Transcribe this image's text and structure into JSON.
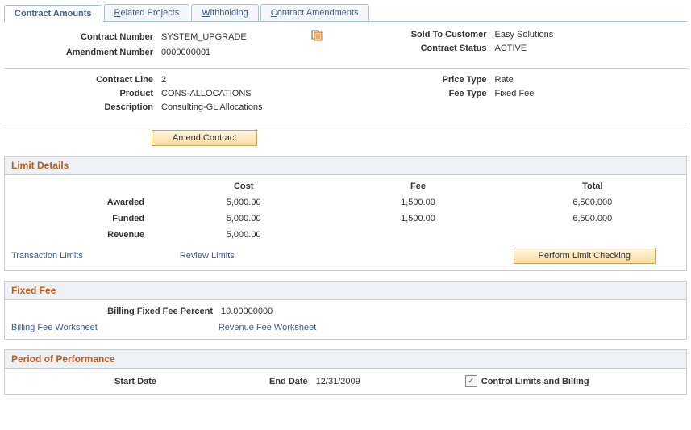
{
  "tabs": {
    "t0": "Contract Amounts",
    "t1_pre": "R",
    "t1_post": "elated Projects",
    "t2_pre": "W",
    "t2_post": "ithholding",
    "t3_pre": "C",
    "t3_post": "ontract Amendments"
  },
  "header": {
    "contract_number_label": "Contract Number",
    "contract_number": "SYSTEM_UPGRADE",
    "amendment_number_label": "Amendment Number",
    "amendment_number": "0000000001",
    "sold_to_label": "Sold To Customer",
    "sold_to": "Easy Solutions",
    "contract_status_label": "Contract Status",
    "contract_status": "ACTIVE",
    "contract_line_label": "Contract Line",
    "contract_line": "2",
    "product_label": "Product",
    "product": "CONS-ALLOCATIONS",
    "description_label": "Description",
    "description": "Consulting-GL Allocations",
    "price_type_label": "Price Type",
    "price_type": "Rate",
    "fee_type_label": "Fee Type",
    "fee_type": "Fixed Fee"
  },
  "actions": {
    "amend": "Amend Contract",
    "limit_check": "Perform Limit Checking"
  },
  "limit_details": {
    "title": "Limit Details",
    "cols": {
      "cost": "Cost",
      "fee": "Fee",
      "total": "Total"
    },
    "rows": {
      "awarded": {
        "label": "Awarded",
        "cost": "5,000.00",
        "fee": "1,500.00",
        "total": "6,500.000"
      },
      "funded": {
        "label": "Funded",
        "cost": "5,000.00",
        "fee": "1,500.00",
        "total": "6,500.000"
      },
      "revenue": {
        "label": "Revenue",
        "cost": "5,000.00",
        "fee": "",
        "total": ""
      }
    },
    "links": {
      "transaction": "Transaction Limits",
      "review": "Review Limits"
    }
  },
  "fixed_fee": {
    "title": "Fixed Fee",
    "percent_label": "Billing Fixed Fee Percent",
    "percent": "10.00000000",
    "links": {
      "billing": "Billing Fee Worksheet",
      "revenue": "Revenue Fee Worksheet"
    }
  },
  "period": {
    "title": "Period of Performance",
    "start_label": "Start Date",
    "start": "",
    "end_label": "End Date",
    "end": "12/31/2009",
    "checkbox_label": "Control Limits and Billing",
    "checked": true
  }
}
